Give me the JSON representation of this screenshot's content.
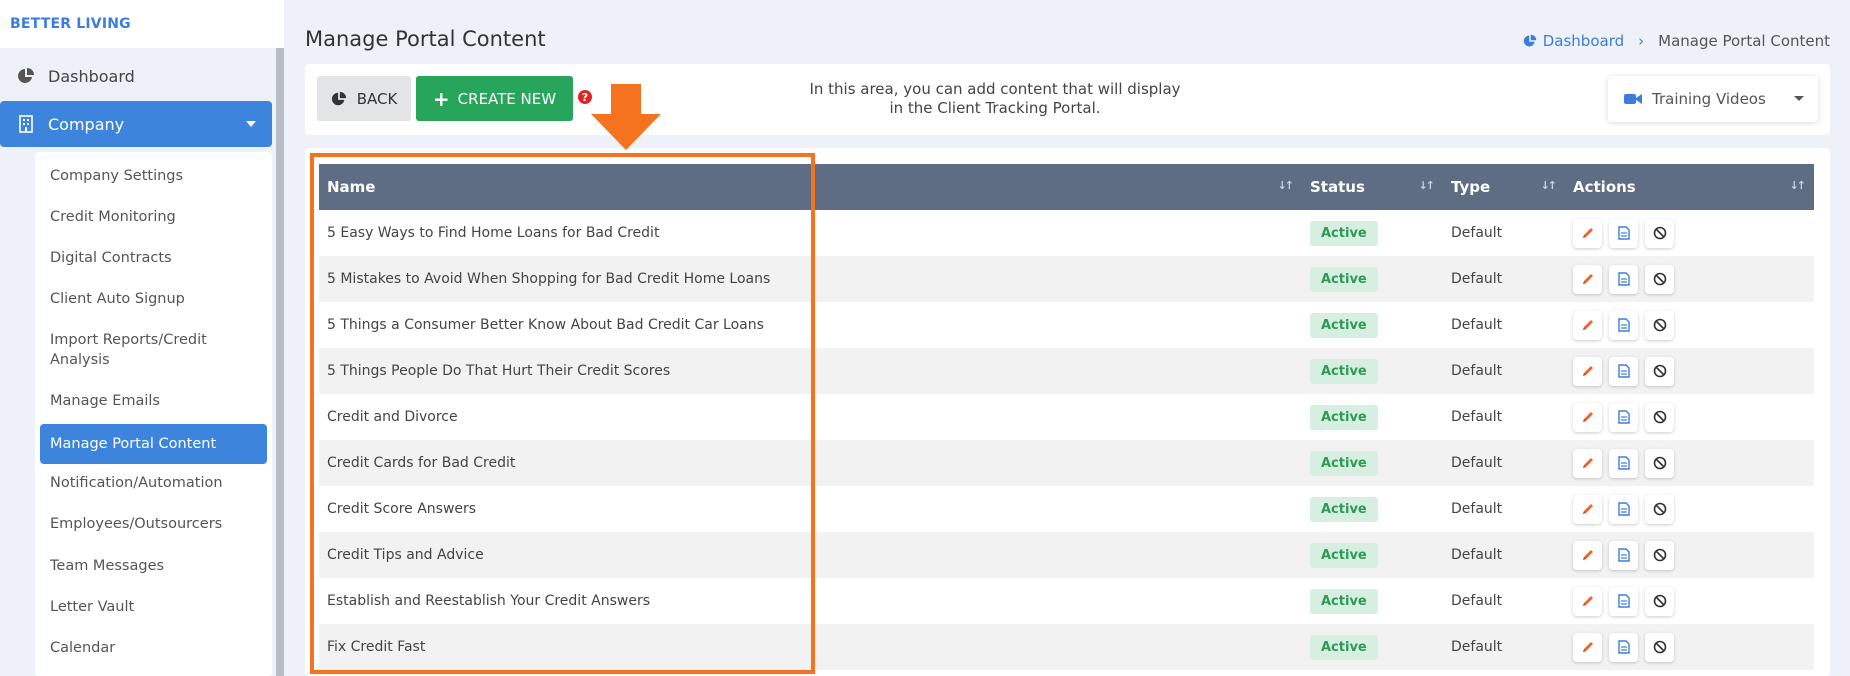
{
  "brand": "BETTER LIVING",
  "sidebar": {
    "dashboard": "Dashboard",
    "company": "Company",
    "submenu": [
      "Company Settings",
      "Credit Monitoring",
      "Digital Contracts",
      "Client Auto Signup",
      "Import Reports/Credit Analysis",
      "Manage Emails",
      "Manage Portal Content",
      "Notification/Automation",
      "Employees/Outsourcers",
      "Team Messages",
      "Letter Vault",
      "Calendar"
    ],
    "active_index": 6
  },
  "page": {
    "title": "Manage Portal Content",
    "breadcrumb": {
      "home": "Dashboard",
      "current": "Manage Portal Content"
    }
  },
  "toolbar": {
    "back_label": "BACK",
    "create_label": "CREATE NEW",
    "help_glyph": "?",
    "info_text": "In this area, you can add content that will display in the Client Tracking Portal.",
    "select_value": "Training Videos"
  },
  "table": {
    "headers": {
      "name": "Name",
      "status": "Status",
      "type": "Type",
      "actions": "Actions"
    },
    "rows": [
      {
        "name": "5 Easy Ways to Find Home Loans for Bad Credit",
        "status": "Active",
        "type": "Default"
      },
      {
        "name": "5 Mistakes to Avoid When Shopping for Bad Credit Home Loans",
        "status": "Active",
        "type": "Default"
      },
      {
        "name": "5 Things a Consumer Better Know About Bad Credit Car Loans",
        "status": "Active",
        "type": "Default"
      },
      {
        "name": "5 Things People Do That Hurt Their Credit Scores",
        "status": "Active",
        "type": "Default"
      },
      {
        "name": "Credit and Divorce",
        "status": "Active",
        "type": "Default"
      },
      {
        "name": "Credit Cards for Bad Credit",
        "status": "Active",
        "type": "Default"
      },
      {
        "name": "Credit Score Answers",
        "status": "Active",
        "type": "Default"
      },
      {
        "name": "Credit Tips and Advice",
        "status": "Active",
        "type": "Default"
      },
      {
        "name": "Establish and Reestablish Your Credit Answers",
        "status": "Active",
        "type": "Default"
      },
      {
        "name": "Fix Credit Fast",
        "status": "Active",
        "type": "Default"
      }
    ]
  },
  "colors": {
    "accent": "#3c84dc",
    "create_button": "#27a55a",
    "annotation": "#f5731e",
    "table_header": "#5e6d83",
    "status_active": "#2e9a56"
  },
  "icons": {
    "dashboard": "pie-chart-icon",
    "company": "building-icon",
    "select": "video-camera-icon",
    "actions": [
      "pencil-icon",
      "document-icon",
      "block-icon"
    ]
  }
}
